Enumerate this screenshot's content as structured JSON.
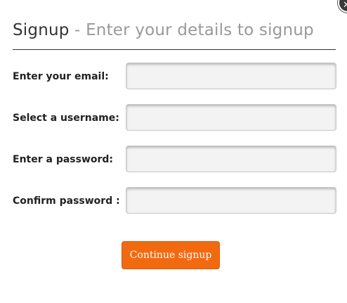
{
  "dialog": {
    "close_icon": "close-icon",
    "close_glyph": "✕"
  },
  "header": {
    "title": "Signup",
    "separator": " - ",
    "subtitle": "Enter your details to signup"
  },
  "form": {
    "fields": [
      {
        "label": "Enter your email:",
        "value": "",
        "type": "text"
      },
      {
        "label": "Select a username:",
        "value": "",
        "type": "text"
      },
      {
        "label": "Enter a password:",
        "value": "",
        "type": "password"
      },
      {
        "label": "Confirm password :",
        "value": "",
        "type": "password"
      }
    ],
    "submit_label": "Continue signup"
  },
  "colors": {
    "accent": "#f26a10",
    "title": "#333333",
    "subtitle": "#999999",
    "input_bg": "#f3f3f3"
  }
}
